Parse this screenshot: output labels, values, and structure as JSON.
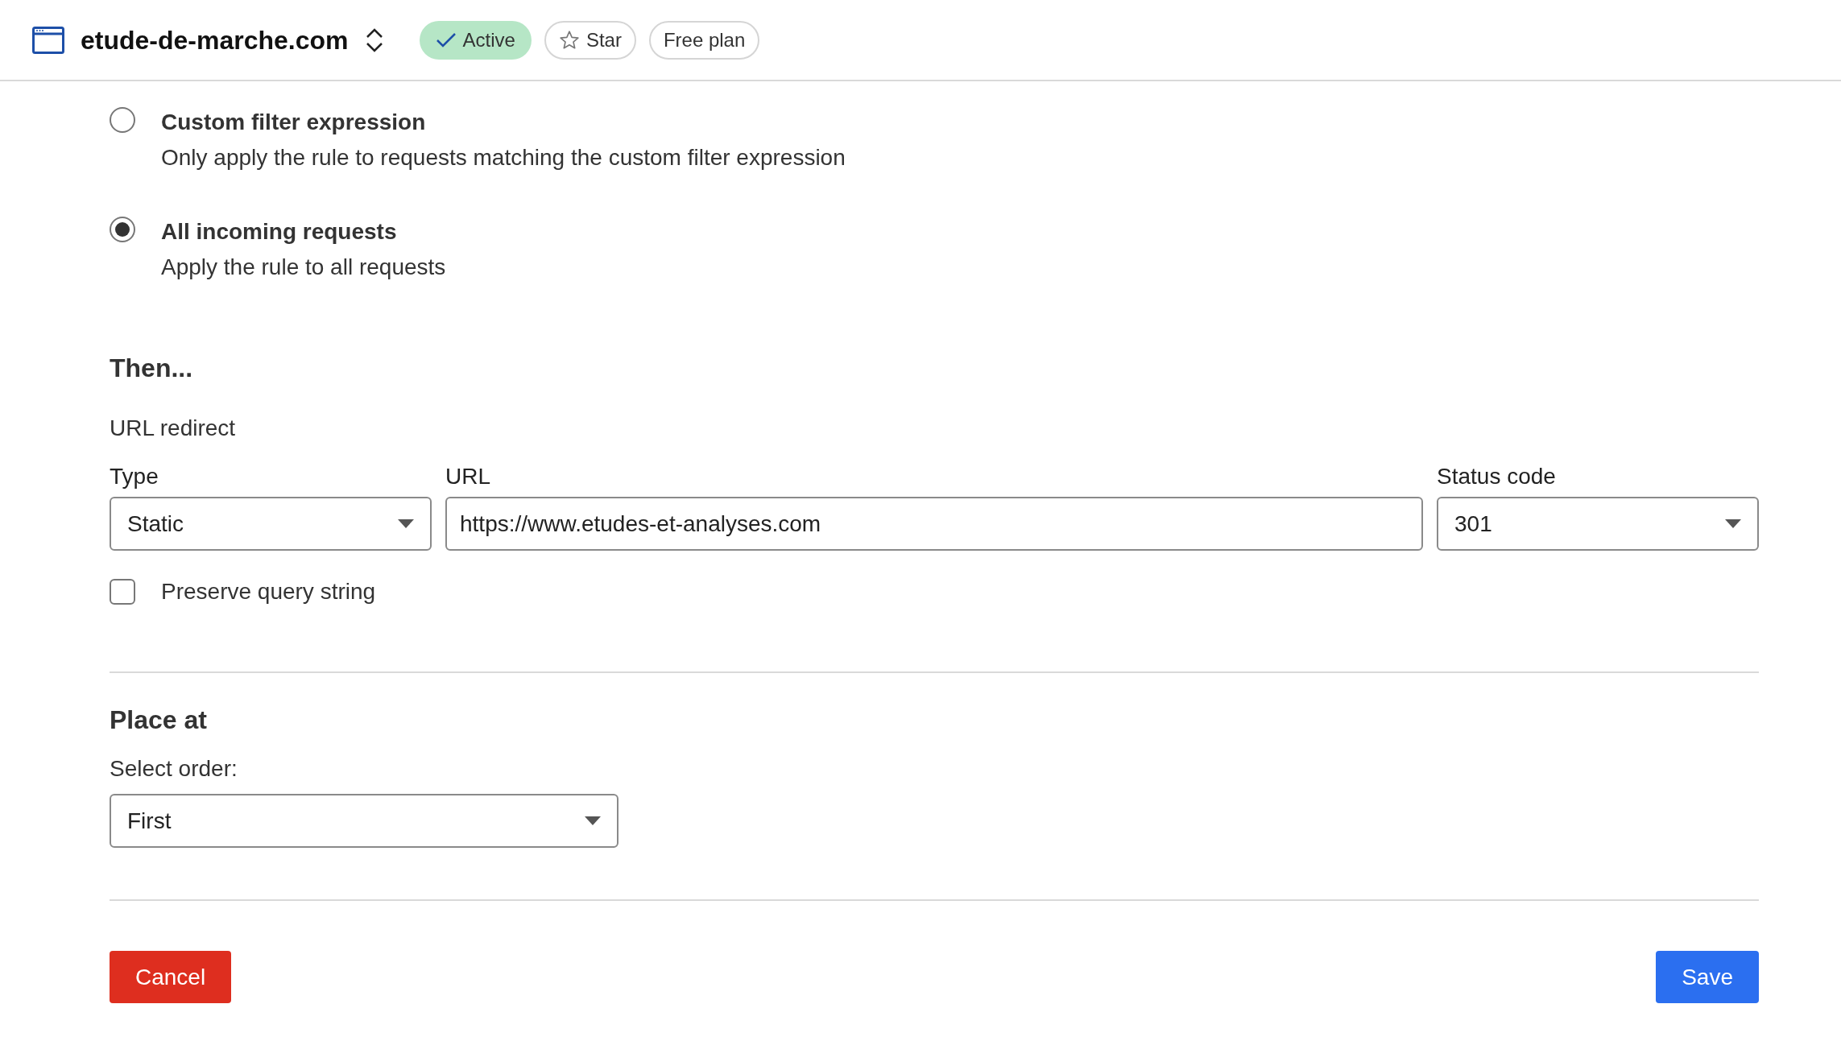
{
  "header": {
    "domain": "etude-de-marche.com",
    "badges": [
      {
        "kind": "status",
        "label": "Active"
      },
      {
        "kind": "star",
        "label": "Star"
      },
      {
        "kind": "plan",
        "label": "Free plan"
      }
    ]
  },
  "match_options": [
    {
      "title": "Custom filter expression",
      "description": "Only apply the rule to requests matching the custom filter expression",
      "selected": false
    },
    {
      "title": "All incoming requests",
      "description": "Apply the rule to all requests",
      "selected": true
    }
  ],
  "then": {
    "heading": "Then...",
    "action": "URL redirect",
    "type": {
      "label": "Type",
      "value": "Static"
    },
    "url": {
      "label": "URL",
      "value": "https://www.etudes-et-analyses.com"
    },
    "status_code": {
      "label": "Status code",
      "value": "301"
    },
    "preserve_query_string": {
      "label": "Preserve query string",
      "checked": false
    }
  },
  "place_at": {
    "heading": "Place at",
    "label": "Select order:",
    "value": "First"
  },
  "buttons": {
    "cancel": "Cancel",
    "save": "Save"
  }
}
